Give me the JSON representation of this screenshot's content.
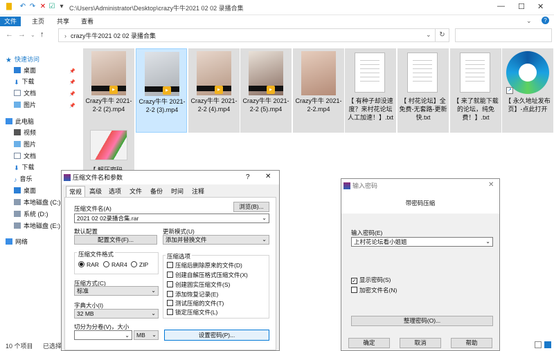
{
  "titlebar": {
    "path": "C:\\Users\\Administrator\\Desktop\\crazy牛牛2021 02 02 录播合集"
  },
  "ribbon": {
    "tabs": [
      "文件",
      "主页",
      "共享",
      "查看"
    ]
  },
  "address": {
    "crumb": "crazy牛牛2021 02 02 录播合集"
  },
  "sidebar": {
    "quick": "快速访问",
    "desktop": "桌面",
    "downloads": "下载",
    "docs": "文档",
    "pictures": "图片",
    "thispc": "此电脑",
    "videos": "视频",
    "pictures2": "图片",
    "docs2": "文档",
    "downloads2": "下载",
    "music": "音乐",
    "desktop2": "桌面",
    "diskc": "本地磁盘 (C:)",
    "diskd": "系统 (D:)",
    "diske": "本地磁盘 (E:)",
    "network": "网络"
  },
  "files": [
    {
      "name": "Crazy牛牛 2021-2-2 (2).mp4"
    },
    {
      "name": "Crazy牛牛 2021-2-2 (3).mp4"
    },
    {
      "name": "Crazy牛牛 2021-2-2 (4).mp4"
    },
    {
      "name": "Crazy牛牛 2021-2-2 (5).mp4"
    },
    {
      "name": "Crazy牛牛 2021-2-2.mp4"
    },
    {
      "name": "【 有种子却没速度？来村花论坛人工加速！】.txt"
    },
    {
      "name": "【 村花论坛】全免费-无套路-更新快.txt"
    },
    {
      "name": "【 来了就能下载的论坛，纯免费！】.txt"
    },
    {
      "name": "【 永久地址发布页】-点此打开"
    },
    {
      "name": "【 解压密码..."
    }
  ],
  "status": {
    "count": "10 个项目",
    "selected": "已选择"
  },
  "archive": {
    "title": "压缩文件名和参数",
    "help_q": "?",
    "tabs": [
      "常规",
      "高级",
      "选项",
      "文件",
      "备份",
      "时间",
      "注释"
    ],
    "name_label": "压缩文件名(A)",
    "browse": "浏览(B)...",
    "name_value": "2021 02 02录播合集.rar",
    "default_cfg": "默认配置",
    "cfg_btn": "配置文件(F)...",
    "update_label": "更新模式(U)",
    "update_value": "添加并替换文件",
    "format_label": "压缩文件格式",
    "fmt_rar": "RAR",
    "fmt_rar4": "RAR4",
    "fmt_zip": "ZIP",
    "opts_label": "压缩选项",
    "opts": [
      "压缩后删除原来的文件(D)",
      "创建自解压格式压缩文件(X)",
      "创建固实压缩文件(S)",
      "添加恢复记录(E)",
      "测试压缩的文件(T)",
      "锁定压缩文件(L)"
    ],
    "method_label": "压缩方式(C)",
    "method_value": "标准",
    "dict_label": "字典大小(I)",
    "dict_value": "32 MB",
    "split_label": "切分为分卷(V)，大小",
    "split_unit": "MB",
    "pwd_btn": "设置密码(P)..."
  },
  "password": {
    "title": "输入密码",
    "header": "带密码压缩",
    "enter_label": "输入密码(E)",
    "value": "上村花论坛看小姐姐",
    "show": "显示密码(S)",
    "encrypt": "加密文件名(N)",
    "manage": "整理密码(O)...",
    "ok": "确定",
    "cancel": "取消",
    "help": "帮助"
  }
}
